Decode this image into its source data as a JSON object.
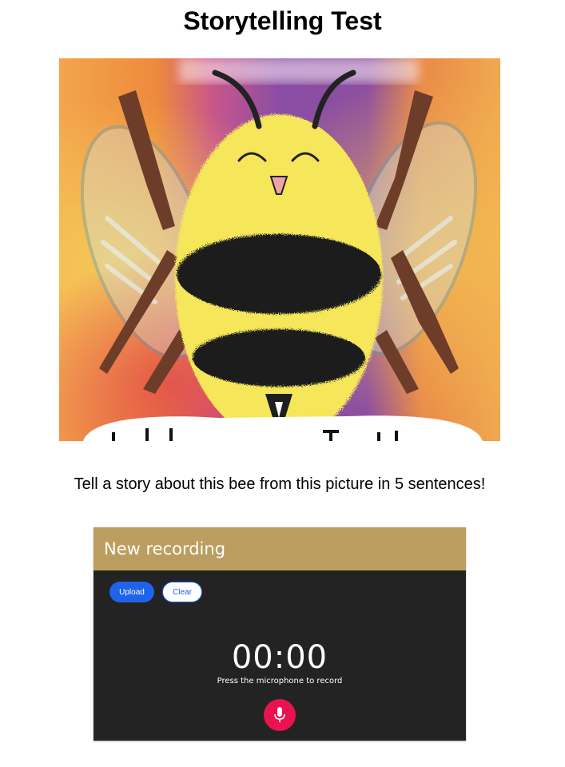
{
  "page": {
    "title": "Storytelling Test",
    "prompt": "Tell a story about this bee from this picture in 5 sentences!"
  },
  "image": {
    "subject": "cartoon bumblebee illustration"
  },
  "recorder": {
    "title": "New recording",
    "upload_label": "Upload",
    "clear_label": "Clear",
    "timer": "00:00",
    "hint": "Press the microphone to record",
    "mic_icon": "microphone-icon",
    "colors": {
      "header": "#bb9e5f",
      "panel": "#232323",
      "primary": "#1e63e9",
      "mic": "#e8134f"
    }
  }
}
